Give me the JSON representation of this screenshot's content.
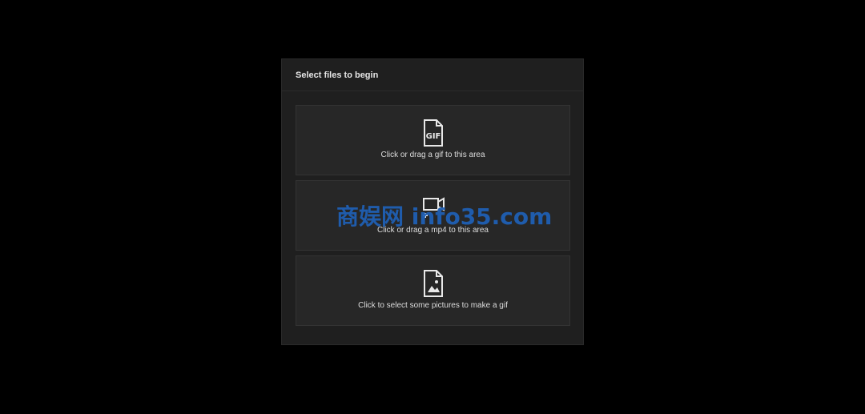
{
  "panel": {
    "title": "Select files to begin"
  },
  "zones": [
    {
      "icon": "gif-file-icon",
      "label": "Click or drag a gif to this area"
    },
    {
      "icon": "video-file-icon",
      "label": "Click or drag a mp4 to this area"
    },
    {
      "icon": "image-file-icon",
      "label": "Click to select some pictures to make a gif"
    }
  ],
  "gif_badge": "GIF",
  "watermark": "商娱网 info35.com",
  "colors": {
    "background": "#000000",
    "panel": "#1f1f1f",
    "zone": "#272727",
    "watermark": "#1f5fb4"
  }
}
